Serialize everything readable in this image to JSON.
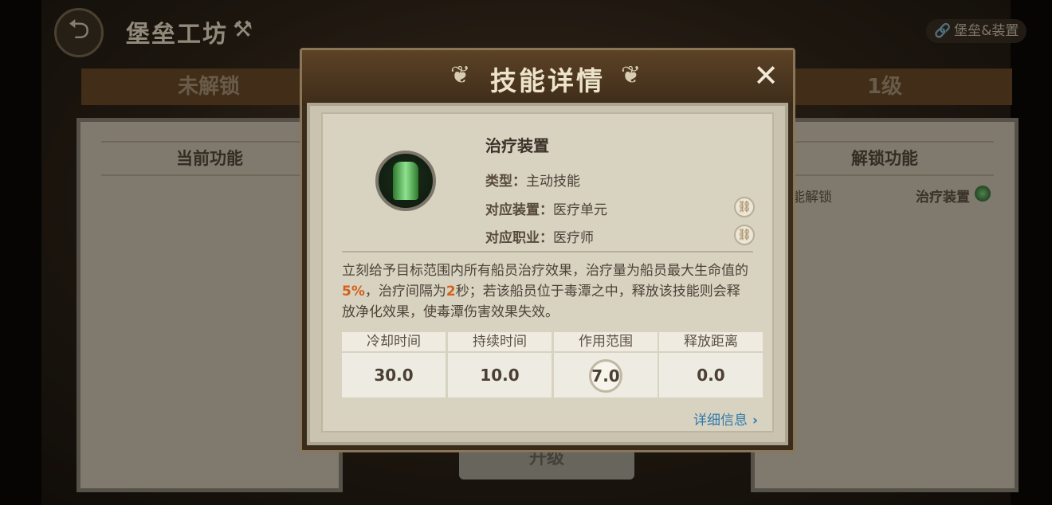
{
  "page": {
    "title": "堡垒工坊",
    "top_link": "堡垒&装置",
    "header_left": "未解锁",
    "header_right": "1级",
    "left_panel_title": "当前功能",
    "right_panel_title": "解锁功能",
    "unlock_left_text": "能解锁",
    "unlock_right_text": "治疗装置",
    "upgrade_label": "升级"
  },
  "modal": {
    "title": "技能详情",
    "skill_name": "治疗装置",
    "type_key": "类型：",
    "type_value": "主动技能",
    "device_key": "对应装置：",
    "device_value": "医疗单元",
    "job_key": "对应职业：",
    "job_value": "医疗师",
    "desc_part1": "立刻给予目标范围内所有船员治疗效果，治疗量为船员最大生命值的",
    "desc_hl1": "5%",
    "desc_part2": "，治疗间隔为",
    "desc_hl2": "2",
    "desc_part3": "秒；若该船员位于毒潭之中，释放该技能则会释放净化效果，使毒潭伤害效果失效。",
    "stats": [
      {
        "label": "冷却时间",
        "value": "30.0"
      },
      {
        "label": "持续时间",
        "value": "10.0"
      },
      {
        "label": "作用范围",
        "value": "7.0"
      },
      {
        "label": "释放距离",
        "value": "0.0"
      }
    ],
    "details_label": "详细信息"
  },
  "colors": {
    "highlight": "#d4601a",
    "link": "#2f7aa8",
    "header_bar": "#6a4a28"
  },
  "icons": {
    "back": "back-arrow-icon",
    "title": "wrench-icon",
    "link": "chain-link-icon",
    "close": "close-icon",
    "chevron": "chevron-right-icon"
  }
}
